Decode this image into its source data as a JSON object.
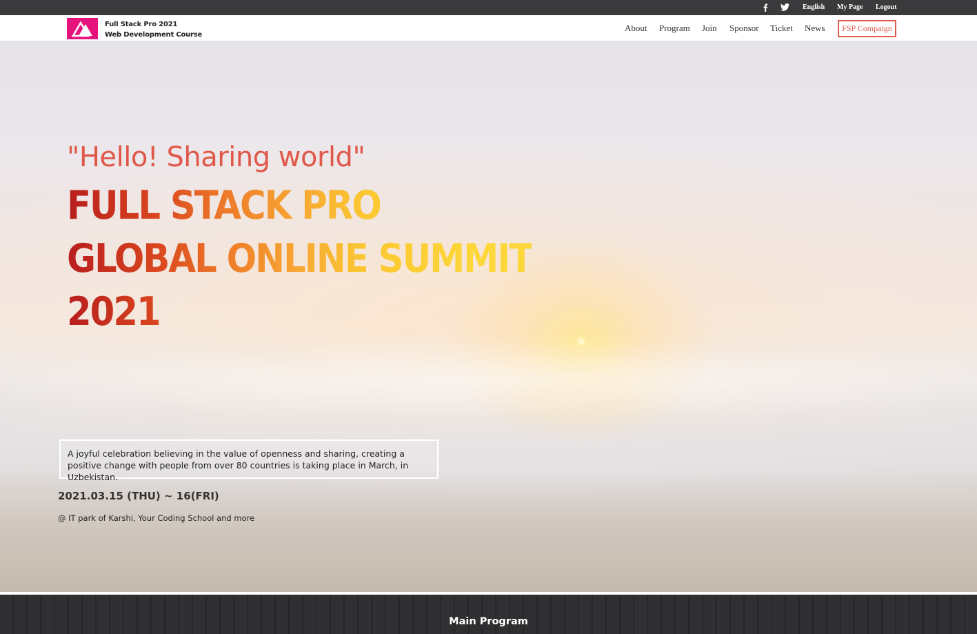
{
  "topbar": {
    "icons": [
      "facebook-icon",
      "twitter-icon"
    ],
    "language": "English",
    "my_page": "My Page",
    "logout": "Logout"
  },
  "brand": {
    "line1": "Full Stack Pro 2021",
    "line2": "Web Development Course",
    "logo_color": "#e6137d"
  },
  "nav": {
    "items": [
      "About",
      "Program",
      "Join",
      "Sponsor",
      "Ticket",
      "News"
    ],
    "campaign": "FSP Compaign",
    "campaign_color": "#e05a4e"
  },
  "hero": {
    "tagline": "\"Hello! Sharing world\"",
    "headline": [
      "FULL STACK PRO",
      "GLOBAL ONLINE SUMMIT",
      "2021"
    ],
    "description": "A joyful celebration believing in the value of openness and sharing, creating a positive change with people from over 80 countries is taking place in March, in Uzbekistan.",
    "date": "2021.03.15 (THU) ~ 16(FRI)",
    "venue": "@ IT park of Karshi, Your Coding School and more"
  },
  "program": {
    "title": "Main Program"
  }
}
